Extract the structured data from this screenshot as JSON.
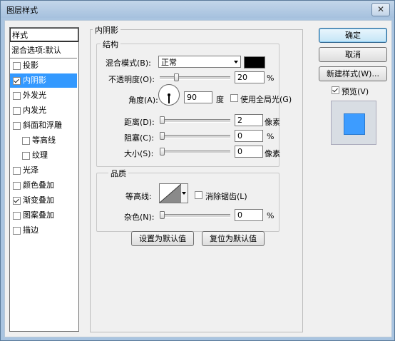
{
  "window": {
    "title": "图层样式",
    "close_label": "✕"
  },
  "styles_list": {
    "header": "样式",
    "blend_options": "混合选项:默认",
    "items": [
      {
        "label": "投影",
        "checked": false,
        "selected": false,
        "indent": false
      },
      {
        "label": "内阴影",
        "checked": true,
        "selected": true,
        "indent": false
      },
      {
        "label": "外发光",
        "checked": false,
        "selected": false,
        "indent": false
      },
      {
        "label": "内发光",
        "checked": false,
        "selected": false,
        "indent": false
      },
      {
        "label": "斜面和浮雕",
        "checked": false,
        "selected": false,
        "indent": false
      },
      {
        "label": "等高线",
        "checked": false,
        "selected": false,
        "indent": true
      },
      {
        "label": "纹理",
        "checked": false,
        "selected": false,
        "indent": true
      },
      {
        "label": "光泽",
        "checked": false,
        "selected": false,
        "indent": false
      },
      {
        "label": "颜色叠加",
        "checked": false,
        "selected": false,
        "indent": false
      },
      {
        "label": "渐变叠加",
        "checked": true,
        "selected": false,
        "indent": false
      },
      {
        "label": "图案叠加",
        "checked": false,
        "selected": false,
        "indent": false
      },
      {
        "label": "描边",
        "checked": false,
        "selected": false,
        "indent": false
      }
    ]
  },
  "inner_shadow": {
    "group_title": "内阴影",
    "structure": {
      "title": "结构",
      "blend_mode_label": "混合模式(B):",
      "blend_mode_value": "正常",
      "shadow_color": "#000000",
      "opacity_label": "不透明度(O):",
      "opacity_value": "20",
      "opacity_unit": "%",
      "opacity_fraction": 0.2,
      "angle_label": "角度(A):",
      "angle_value": "90",
      "angle_unit": "度",
      "global_light_label": "使用全局光(G)",
      "global_light_checked": false,
      "distance_label": "距离(D):",
      "distance_value": "2",
      "distance_unit": "像素",
      "distance_fraction": 0.0,
      "choke_label": "阻塞(C):",
      "choke_value": "0",
      "choke_unit": "%",
      "choke_fraction": 0.0,
      "size_label": "大小(S):",
      "size_value": "0",
      "size_unit": "像素",
      "size_fraction": 0.0
    },
    "quality": {
      "title": "品质",
      "contour_label": "等高线:",
      "anti_alias_label": "消除锯齿(L)",
      "anti_alias_checked": false,
      "noise_label": "杂色(N):",
      "noise_value": "0",
      "noise_unit": "%",
      "noise_fraction": 0.0
    },
    "make_default_label": "设置为默认值",
    "reset_default_label": "复位为默认值"
  },
  "actions": {
    "ok_label": "确定",
    "cancel_label": "取消",
    "new_style_label": "新建样式(W)...",
    "preview_label": "预览(V)",
    "preview_checked": true
  },
  "colors": {
    "selection": "#3399ff",
    "preview_fill": "#3d9cff"
  }
}
